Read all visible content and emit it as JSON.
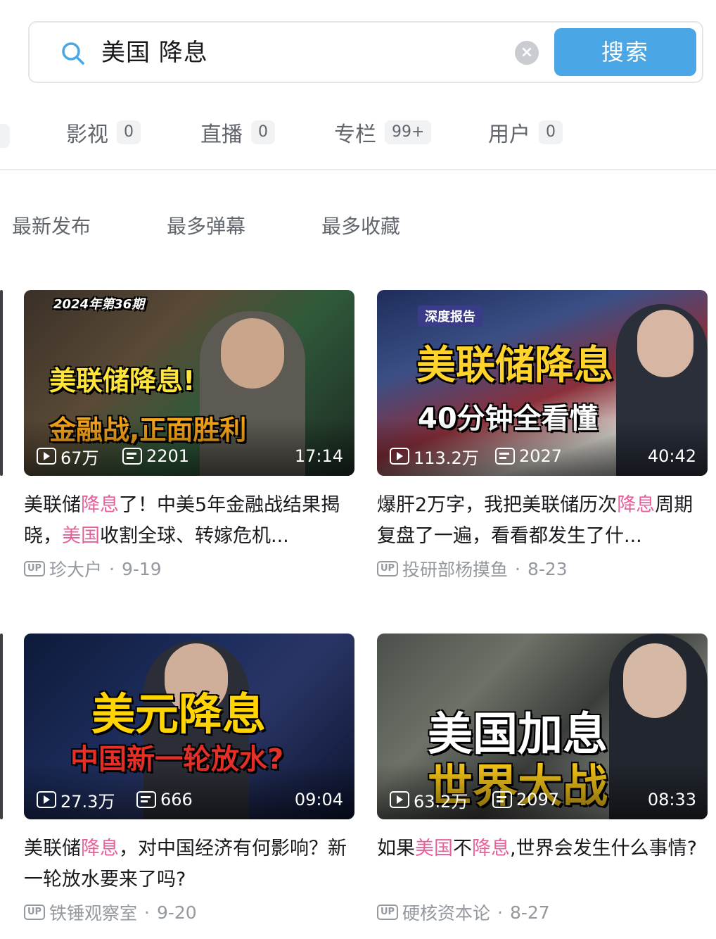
{
  "search": {
    "query": "美国 降息",
    "clear_symbol": "×",
    "button_label": "搜索"
  },
  "tabs": [
    {
      "label": "影视",
      "count": "0"
    },
    {
      "label": "直播",
      "count": "0"
    },
    {
      "label": "专栏",
      "count": "99+"
    },
    {
      "label": "用户",
      "count": "0"
    }
  ],
  "sort_options": [
    "最新发布",
    "最多弹幕",
    "最多收藏"
  ],
  "videos": [
    {
      "thumb_text": [
        "2024年第36期",
        "美联储降息!",
        "金融战,正面胜利"
      ],
      "views": "67万",
      "danmaku": "2201",
      "duration": "17:14",
      "title_parts": [
        "美联储",
        "降息",
        "了！中美5年金融战结果揭晓，",
        "美国",
        "收割全球、转嫁危机..."
      ],
      "uploader": "珍大户",
      "date": "9-19"
    },
    {
      "thumb_text": [
        "深度报告",
        "美联储降息",
        "40分钟全看懂"
      ],
      "views": "113.2万",
      "danmaku": "2027",
      "duration": "40:42",
      "title_parts": [
        "爆肝2万字，我把美联储历次",
        "降息",
        "周期复盘了一遍，看看都发生了什..."
      ],
      "uploader": "投研部杨摸鱼",
      "date": "8-23"
    },
    {
      "thumb_text": [
        "美元降息",
        "中国新一轮放水?"
      ],
      "views": "27.3万",
      "danmaku": "666",
      "duration": "09:04",
      "title_parts": [
        "美联储",
        "降息",
        "，对中国经济有何影响？新一轮放水要来了吗?"
      ],
      "uploader": "铁锤观察室",
      "date": "9-20"
    },
    {
      "thumb_text": [
        "美国加息",
        "世界大战"
      ],
      "views": "63.2万",
      "danmaku": "2097",
      "duration": "08:33",
      "title_parts": [
        "如果",
        "美国",
        "不",
        "降息",
        ",世界会发生什么事情?"
      ],
      "uploader": "硬核资本论",
      "date": "8-27"
    }
  ],
  "up_badge_text": "UP",
  "meta_separator": "·",
  "colors": {
    "accent": "#4aa6e4",
    "highlight": "#e8609a",
    "muted": "#9499a0"
  }
}
